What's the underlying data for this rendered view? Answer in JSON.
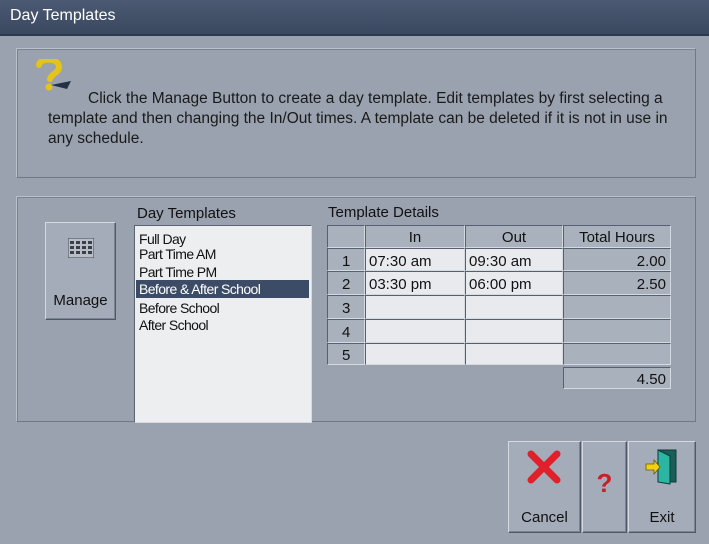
{
  "window": {
    "title": "Day Templates"
  },
  "help": {
    "text": "Click the Manage Button to create a day template. Edit templates by first selecting a template and then changing the In/Out times. A template can be deleted if it is not in use in any schedule."
  },
  "manage_button": {
    "label": "Manage"
  },
  "templates": {
    "heading": "Day Templates",
    "items": [
      "Full Day",
      "Part Time AM",
      "Part Time PM",
      "Before & After School",
      "Before School",
      "After School"
    ],
    "selected": "Before & After School"
  },
  "details": {
    "heading": "Template Details",
    "columns": [
      "",
      "In",
      "Out",
      "Total Hours"
    ],
    "rows": [
      {
        "num": "1",
        "in": "07:30 am",
        "out": "09:30 am",
        "total": "2.00"
      },
      {
        "num": "2",
        "in": "03:30 pm",
        "out": "06:00 pm",
        "total": "2.50"
      },
      {
        "num": "3",
        "in": "",
        "out": "",
        "total": ""
      },
      {
        "num": "4",
        "in": "",
        "out": "",
        "total": ""
      },
      {
        "num": "5",
        "in": "",
        "out": "",
        "total": ""
      }
    ],
    "grand_total": "4.50"
  },
  "buttons": {
    "cancel": "Cancel",
    "help": "?",
    "exit": "Exit"
  },
  "colors": {
    "titlebar": "#3a4860",
    "selection": "#3d4c66",
    "cancel_icon": "#e0202a",
    "help_icon": "#c8202a",
    "exit_icon": "#1ea090"
  }
}
